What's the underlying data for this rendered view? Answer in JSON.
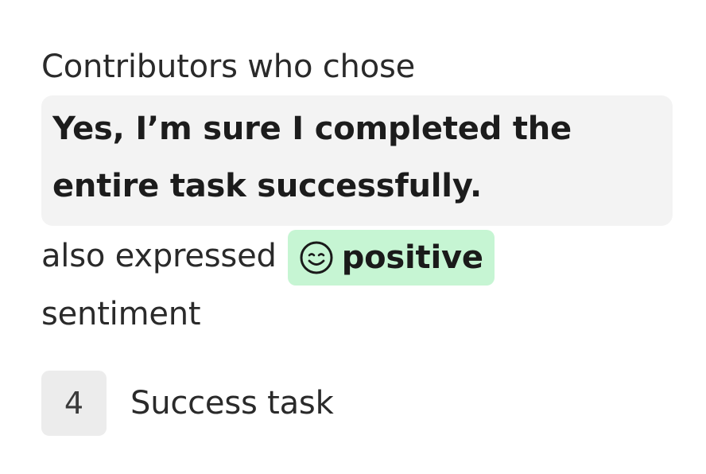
{
  "intro_text": "Contributors who chose",
  "chosen_answer": "Yes, I’m sure I completed the entire task successfully.",
  "sentiment_prefix": "also expressed",
  "sentiment": {
    "label": "positive",
    "icon": "smiley-face-icon",
    "badge_color": "#c6f5d3"
  },
  "sentiment_suffix": "sentiment",
  "footer": {
    "count": "4",
    "label": "Success task"
  }
}
